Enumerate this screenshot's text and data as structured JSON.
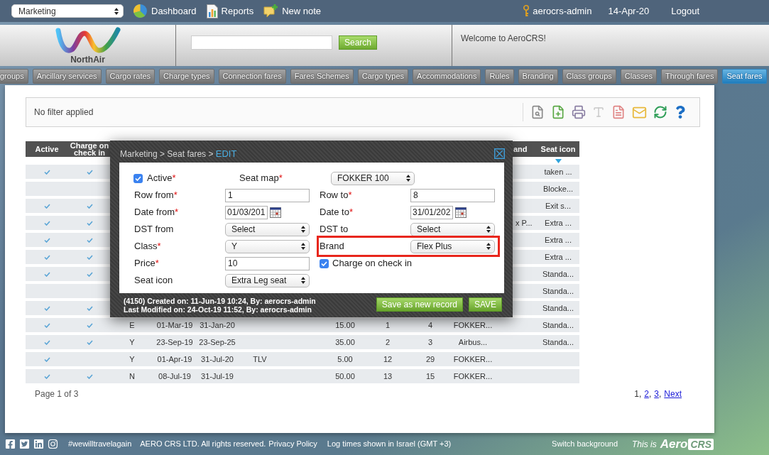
{
  "top_bar": {
    "module_select": {
      "value": "Marketing"
    },
    "links": [
      {
        "kind": "chart",
        "label": "Dashboard"
      },
      {
        "kind": "report",
        "label": "Reports"
      },
      {
        "kind": "note",
        "label": "New note"
      }
    ],
    "user": "aerocrs-admin",
    "date": "14-Apr-20",
    "logout": "Logout"
  },
  "header": {
    "logo_text": "NorthAir",
    "search": {
      "button": "Search"
    },
    "welcome": "Welcome to AeroCRS!"
  },
  "tabs": [
    {
      "label": "groups",
      "selected": false
    },
    {
      "label": "Ancillary services",
      "selected": false
    },
    {
      "label": "Cargo rates",
      "selected": false
    },
    {
      "label": "Charge types",
      "selected": false
    },
    {
      "label": "Connection fares",
      "selected": false
    },
    {
      "label": "Fares Schemes",
      "selected": false
    },
    {
      "label": "Cargo types",
      "selected": false
    },
    {
      "label": "Accommodations",
      "selected": false
    },
    {
      "label": "Rules",
      "selected": false
    },
    {
      "label": "Branding",
      "selected": false
    },
    {
      "label": "Class groups",
      "selected": false
    },
    {
      "label": "Classes",
      "selected": false
    },
    {
      "label": "Through fares",
      "selected": false
    },
    {
      "label": "Seat fares",
      "selected": true
    }
  ],
  "filter_bar": {
    "text": "No filter applied"
  },
  "table": {
    "columns": [
      {
        "label": "Active",
        "sorted": false
      },
      {
        "label": "Charge on check in",
        "sorted": false
      },
      {
        "label": "and",
        "sorted": false
      },
      {
        "label": "Seat icon",
        "sorted": true
      }
    ],
    "rows": [
      {
        "active": true,
        "charge_on_check_in": true,
        "seat_icon": "taken ..."
      },
      {
        "active": false,
        "charge_on_check_in": false,
        "seat_icon": "Blocke..."
      },
      {
        "active": true,
        "charge_on_check_in": true,
        "seat_icon": "Exit s..."
      },
      {
        "active": true,
        "charge_on_check_in": true,
        "column_12": "x P...",
        "seat_icon": "Extra ..."
      },
      {
        "active": true,
        "charge_on_check_in": true,
        "seat_icon": "Extra ..."
      },
      {
        "active": true,
        "charge_on_check_in": true,
        "seat_icon": "Extra ..."
      },
      {
        "active": true,
        "charge_on_check_in": true,
        "seat_icon": "Standa..."
      },
      {
        "active": false,
        "charge_on_check_in": false,
        "seat_icon": "Standa..."
      },
      {
        "active": true,
        "charge_on_check_in": true,
        "seat_icon": "Standa..."
      },
      {
        "active": true,
        "charge_on_check_in": true,
        "column_3": "E",
        "column_4": "01-Mar-19",
        "column_5": "31-Jan-20",
        "column_8": "15.00",
        "column_9": "1",
        "column_10": "4",
        "column_11": "FOKKER...",
        "seat_icon": "Standa..."
      },
      {
        "active": true,
        "charge_on_check_in": true,
        "column_3": "Y",
        "column_4": "23-Sep-19",
        "column_5": "23-Sep-25",
        "column_8": "35.00",
        "column_9": "2",
        "column_10": "3",
        "column_11": "Airbus...",
        "seat_icon": "Standa..."
      },
      {
        "active": true,
        "charge_on_check_in": false,
        "column_3": "Y",
        "column_4": "01-Apr-19",
        "column_5": "31-Jul-20",
        "column_6": "TLV",
        "column_8": "5.00",
        "column_9": "12",
        "column_10": "29",
        "column_11": "FOKKER..."
      },
      {
        "active": true,
        "charge_on_check_in": true,
        "column_3": "N",
        "column_4": "08-Jul-19",
        "column_5": "31-Jul-19",
        "column_8": "50.00",
        "column_9": "13",
        "column_10": "15",
        "column_11": "FOKKER..."
      }
    ]
  },
  "pagination": {
    "summary": "Page 1 of 3",
    "pages": [
      {
        "label": "1",
        "selected": true
      },
      {
        "label": "2",
        "selected": false
      },
      {
        "label": "3",
        "selected": false
      }
    ],
    "separator": ",",
    "next": "Next"
  },
  "dialog": {
    "breadcrumb": "Marketing > Seat fares >",
    "mode": "EDIT",
    "fields": [
      [
        {
          "kind": "checkbox",
          "label": "Active",
          "required_mark": "*",
          "checked": true
        },
        {
          "kind": "select",
          "label": "Seat map",
          "required_mark": "*",
          "value": "FOKKER 100"
        }
      ],
      [
        {
          "kind": "input",
          "label": "Row from",
          "required_mark": "*",
          "value": "1"
        },
        {
          "kind": "input",
          "label": "Row to",
          "required_mark": "*",
          "value": "8"
        }
      ],
      [
        {
          "kind": "date",
          "label": "Date from",
          "required_mark": "*",
          "value": "01/03/201"
        },
        {
          "kind": "date",
          "label": "Date to",
          "required_mark": "*",
          "value": "31/01/202"
        }
      ],
      [
        {
          "kind": "select",
          "label": "DST from",
          "value": "Select"
        },
        {
          "kind": "select",
          "label": "DST to",
          "value": "Select"
        }
      ],
      [
        {
          "kind": "select",
          "label": "Class",
          "required_mark": "*",
          "value": "Y"
        },
        {
          "kind": "select",
          "label": "Brand",
          "value": "Flex Plus",
          "highlighted": true
        }
      ],
      [
        {
          "kind": "input",
          "label": "Price",
          "required_mark": "*",
          "value": "10"
        },
        {
          "kind": "checkbox",
          "label": "Charge on check in",
          "checked": true
        }
      ],
      [
        {
          "kind": "select",
          "label": "Seat icon",
          "value": "Extra Leg seat"
        }
      ]
    ],
    "info": [
      "(4150) Created on: 11-Jun-19 10:24, By: aerocrs-admin",
      "Last Modified on: 24-Oct-19 11:52, By: aerocrs-admin"
    ],
    "buttons": [
      "Save as new record",
      "SAVE"
    ]
  },
  "footer": {
    "hashtag": "#wewilltravelagain",
    "copyright": "AERO CRS LTD. All rights reserved.",
    "privacy_link": "Privacy Policy",
    "log_note": "Log times shown in Israel (GMT +3)",
    "switch_background": "Switch background",
    "brand_lead": "This is",
    "brand_logo": [
      "Aero",
      "CRS"
    ]
  }
}
